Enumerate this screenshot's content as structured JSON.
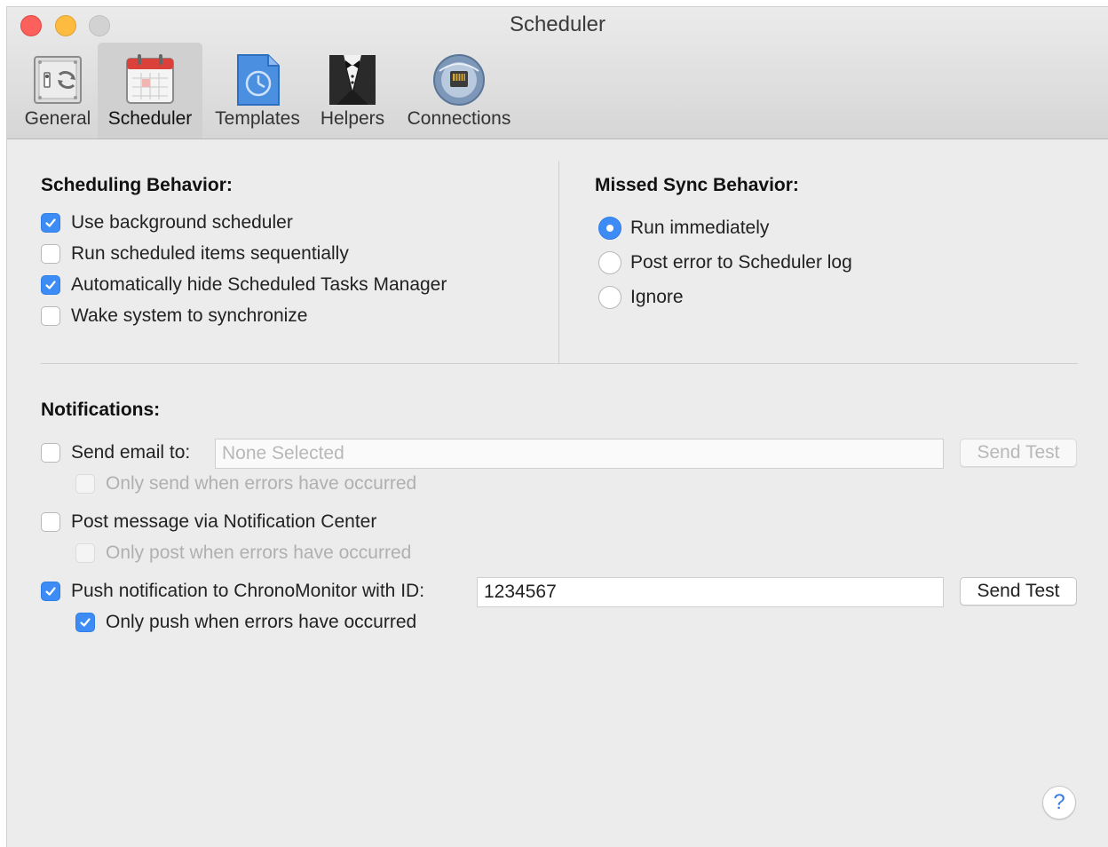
{
  "window": {
    "title": "Scheduler"
  },
  "tabs": [
    {
      "label": "General",
      "icon": "switch-sync-icon"
    },
    {
      "label": "Scheduler",
      "icon": "calendar-icon",
      "selected": true
    },
    {
      "label": "Templates",
      "icon": "template-clock-icon"
    },
    {
      "label": "Helpers",
      "icon": "tuxedo-icon"
    },
    {
      "label": "Connections",
      "icon": "network-globe-icon"
    }
  ],
  "scheduling": {
    "title": "Scheduling Behavior:",
    "options": [
      {
        "label": "Use background scheduler",
        "checked": true
      },
      {
        "label": "Run scheduled items sequentially",
        "checked": false
      },
      {
        "label": "Automatically hide Scheduled Tasks Manager",
        "checked": true
      },
      {
        "label": "Wake system to synchronize",
        "checked": false
      }
    ]
  },
  "missed_sync": {
    "title": "Missed Sync Behavior:",
    "options": [
      {
        "label": "Run immediately",
        "selected": true
      },
      {
        "label": "Post error to Scheduler log",
        "selected": false
      },
      {
        "label": "Ignore",
        "selected": false
      }
    ]
  },
  "notifications": {
    "title": "Notifications:",
    "email": {
      "label": "Send email to:",
      "checked": false,
      "placeholder": "None Selected",
      "send_test": "Send Test",
      "sub_label": "Only send when errors have occurred",
      "sub_checked": false
    },
    "notification_center": {
      "label": "Post message via Notification Center",
      "checked": false,
      "sub_label": "Only post when errors have occurred",
      "sub_checked": false
    },
    "push": {
      "label": "Push notification to ChronoMonitor with ID:",
      "checked": true,
      "value": "1234567",
      "send_test": "Send Test",
      "sub_label": "Only push when errors have occurred",
      "sub_checked": true
    }
  },
  "help": {
    "label": "?"
  },
  "colors": {
    "accent": "#3d8cf5",
    "close": "#fc605c",
    "minimize": "#fdbc40"
  }
}
